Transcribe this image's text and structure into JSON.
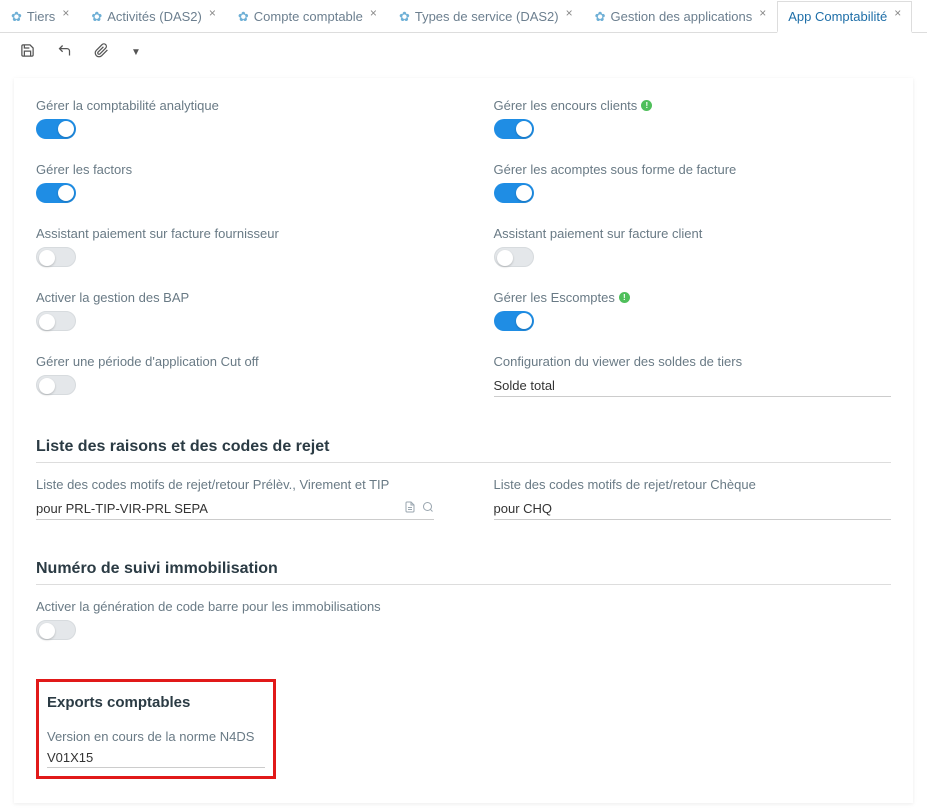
{
  "tabs": [
    {
      "label": "Tiers"
    },
    {
      "label": "Activités (DAS2)"
    },
    {
      "label": "Compte comptable"
    },
    {
      "label": "Types de service (DAS2)"
    },
    {
      "label": "Gestion des applications"
    },
    {
      "label": "App Comptabilité"
    }
  ],
  "left": {
    "analytic_label": "Gérer la comptabilité analytique",
    "factors_label": "Gérer les factors",
    "assist_supplier_label": "Assistant paiement sur facture fournisseur",
    "bap_label": "Activer la gestion des BAP",
    "cutoff_label": "Gérer une période d'application Cut off"
  },
  "right": {
    "encours_label": "Gérer les encours clients",
    "acomptes_label": "Gérer les acomptes sous forme de facture",
    "assist_client_label": "Assistant paiement sur facture client",
    "escomptes_label": "Gérer les Escomptes",
    "viewer_label": "Configuration du viewer des soldes de tiers",
    "viewer_value": "Solde total"
  },
  "section_rejet": {
    "title": "Liste des raisons et des codes de rejet",
    "l1_label": "Liste des codes motifs de rejet/retour Prélèv., Virement et TIP",
    "l1_value": "pour PRL-TIP-VIR-PRL SEPA",
    "l2_label": "Liste des codes motifs de rejet/retour Chèque",
    "l2_value": "pour CHQ"
  },
  "section_immo": {
    "title": "Numéro de suivi immobilisation",
    "barcode_label": "Activer la génération de code barre pour les immobilisations"
  },
  "section_export": {
    "title": "Exports comptables",
    "n4ds_label": "Version en cours de la norme N4DS",
    "n4ds_value": "V01X15"
  }
}
